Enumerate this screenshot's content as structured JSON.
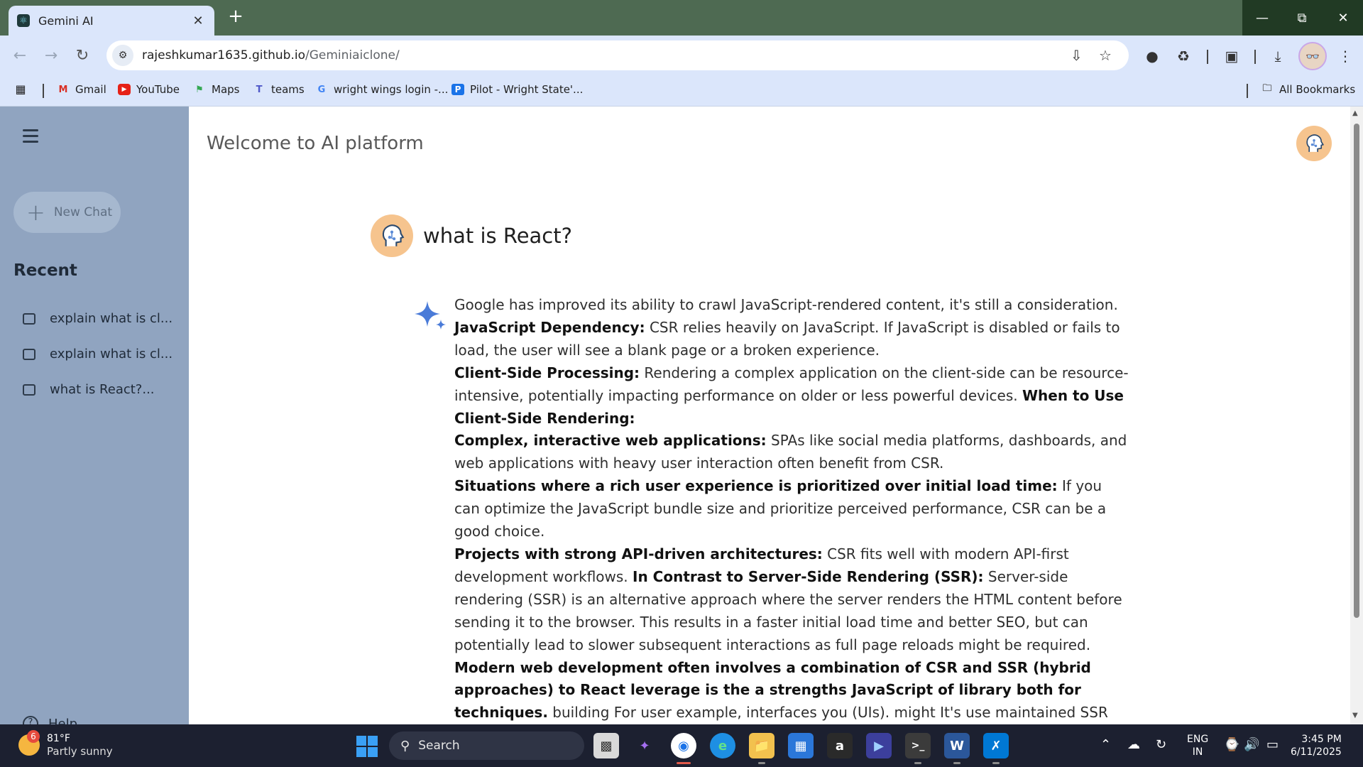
{
  "browser": {
    "tab_title": "Gemini AI",
    "tab_close": "✕",
    "new_tab": "+",
    "url_domain": "rajeshkumar1635.github.io",
    "url_path": "/Geminiaiclone/",
    "bookmarks": [
      "Gmail",
      "YouTube",
      "Maps",
      "teams",
      "wright wings login -...",
      "Pilot - Wright State'..."
    ],
    "all_bookmarks": "All Bookmarks"
  },
  "sidebar": {
    "new_chat": "New Chat",
    "recent_title": "Recent",
    "recent_items": [
      "explain what is cl...",
      "explain what is cl...",
      "what is React?..."
    ],
    "help": "Help"
  },
  "main": {
    "page_title": "Welcome to AI platform",
    "question": "what is React?",
    "answer": [
      {
        "text": "Google has improved its ability to crawl JavaScript-rendered content, it's still a consideration."
      },
      {
        "bold": "JavaScript Dependency:",
        "text": " CSR relies heavily on JavaScript. If JavaScript is disabled or fails to load, the user will see a blank page or a broken experience."
      },
      {
        "bold": "Client-Side Processing:",
        "text": " Rendering a complex application on the client-side can be resource-intensive, potentially impacting performance on older or less powerful devices. ",
        "bold2": "When to Use Client-Side Rendering:"
      },
      {
        "bold": "Complex, interactive web applications:",
        "text": " SPAs like social media platforms, dashboards, and web applications with heavy user interaction often benefit from CSR."
      },
      {
        "bold": "Situations where a rich user experience is prioritized over initial load time:",
        "text": " If you can optimize the JavaScript bundle size and prioritize perceived performance, CSR can be a good choice."
      },
      {
        "bold": "Projects with strong API-driven architectures:",
        "text": " CSR fits well with modern API-first development workflows. ",
        "bold2": "In Contrast to Server-Side Rendering (SSR):",
        "text2": " Server-side rendering (SSR) is an alternative approach where the server renders the HTML content before sending it to the browser. This results in a faster initial load time and better SEO, but can potentially lead to slower subsequent interactions as full page reloads might be required. ",
        "bold3": "Modern web development often involves a combination of CSR and SSR (hybrid approaches) to React leverage is the a strengths JavaScript of library both for techniques.",
        "text3": " building For user example, interfaces you (UIs). might It's use maintained SSR by for Facebook the and initial a page community load of and individual SEO-sensitive developers content, and while companies. using Think CSR of for it the as dynamic a parts toolbox of specifically the"
      }
    ]
  },
  "taskbar": {
    "weather_badge": "6",
    "temperature": "81°F",
    "weather_desc": "Partly sunny",
    "search_placeholder": "Search",
    "lang_top": "ENG",
    "lang_bottom": "IN",
    "time": "3:45 PM",
    "date": "6/11/2025"
  },
  "colors": {
    "tabbar": "#4e6a52",
    "toolbar": "#dbe6fb",
    "sidebar": "#90a4c0",
    "avatar": "#f6c48e",
    "sparkle": "#4a7bd8",
    "taskbar": "#1c2030"
  }
}
